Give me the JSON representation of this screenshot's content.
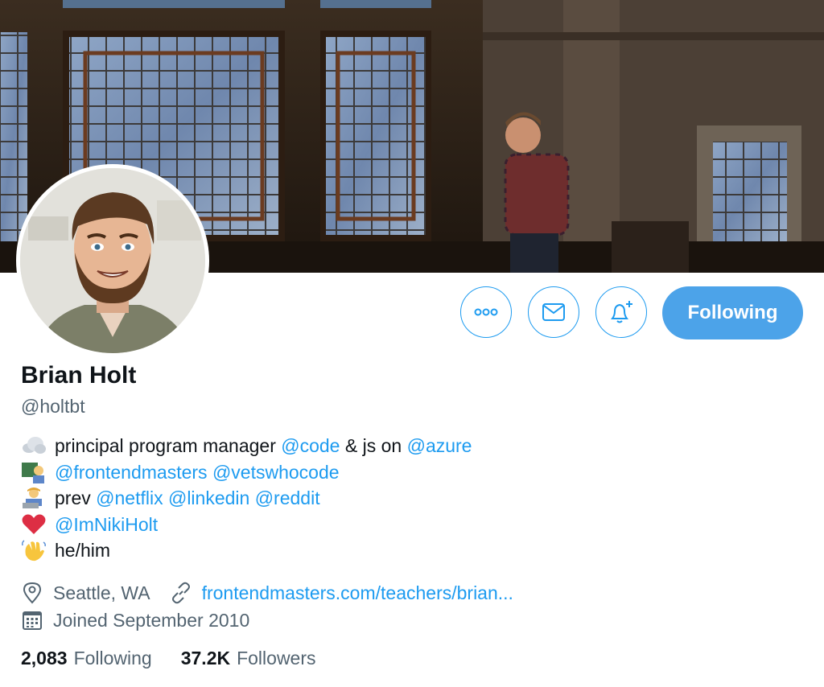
{
  "profile": {
    "name": "Brian Holt",
    "handle": "@holtbt"
  },
  "actions": {
    "more_icon": "more-icon",
    "message_icon": "mail-icon",
    "notify_icon": "bell-plus-icon",
    "follow_label": "Following"
  },
  "bio": {
    "line1": {
      "emoji": "cloud-emoji",
      "text1": "principal program manager ",
      "mention1": "@code",
      "text2": " & js on ",
      "mention2": "@azure"
    },
    "line2": {
      "emoji": "teacher-emoji",
      "mention1": "@frontendmasters",
      "mention2": "@vetswhocode"
    },
    "line3": {
      "emoji": "technologist-emoji",
      "text1": "prev ",
      "mention1": "@netflix",
      "mention2": "@linkedin",
      "mention3": "@reddit"
    },
    "line4": {
      "emoji": "red-heart-emoji",
      "mention1": "@ImNikiHolt"
    },
    "line5": {
      "emoji": "waving-hand-emoji",
      "text1": "he/him"
    }
  },
  "meta": {
    "location": "Seattle, WA",
    "website": "frontendmasters.com/teachers/brian...",
    "joined": "Joined September 2010"
  },
  "stats": {
    "following_count": "2,083",
    "following_label": "Following",
    "followers_count": "37.2K",
    "followers_label": "Followers"
  },
  "colors": {
    "accent": "#1d9bf0",
    "follow_button": "#4ca3e9",
    "secondary_text": "#536471"
  }
}
